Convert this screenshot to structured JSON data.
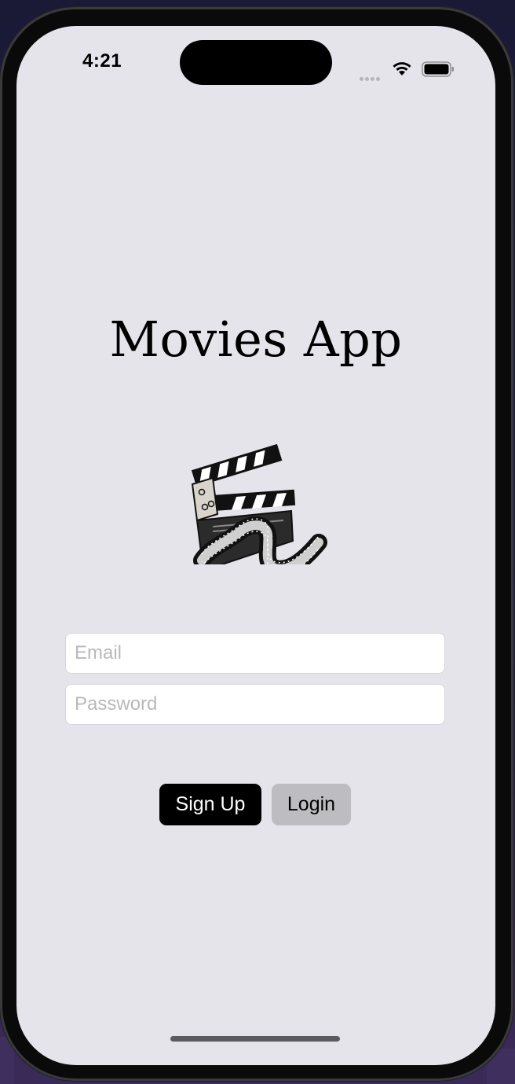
{
  "status_bar": {
    "time": "4:21"
  },
  "app": {
    "title": "Movies App",
    "logo_icon": "clapperboard-film-reel-icon"
  },
  "form": {
    "email_placeholder": "Email",
    "email_value": "",
    "password_placeholder": "Password",
    "password_value": ""
  },
  "buttons": {
    "signup_label": "Sign Up",
    "login_label": "Login"
  },
  "colors": {
    "screen_background": "#e5e4ea",
    "primary_button": "#000000",
    "secondary_button": "#bdbcc1"
  }
}
